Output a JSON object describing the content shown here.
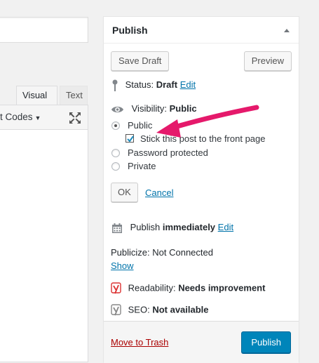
{
  "editor": {
    "tabs": [
      "Visual",
      "Text"
    ],
    "toolbar_label": "t Codes",
    "toolbar_caret": "▼"
  },
  "publish": {
    "title": "Publish",
    "save_draft_label": "Save Draft",
    "preview_label": "Preview",
    "status_label": "Status:",
    "status_value": "Draft",
    "status_edit": "Edit",
    "visibility_label": "Visibility:",
    "visibility_value": "Public",
    "options": {
      "public": "Public",
      "sticky": "Stick this post to the front page",
      "password": "Password protected",
      "private": "Private"
    },
    "ok_label": "OK",
    "cancel_label": "Cancel",
    "schedule_label": "Publish",
    "schedule_value": "immediately",
    "schedule_edit": "Edit",
    "publicize_label": "Publicize: Not Connected",
    "publicize_show": "Show",
    "readability_label": "Readability:",
    "readability_value": "Needs improvement",
    "seo_label": "SEO:",
    "seo_value": "Not available",
    "trash_label": "Move to Trash",
    "publish_label": "Publish"
  },
  "colors": {
    "accent": "#0085ba",
    "link": "#0073aa",
    "trash": "#aa0000",
    "annotation_arrow": "#e5196b",
    "yoast_red": "#dc3232"
  },
  "icons": [
    "pin-icon",
    "eye-icon",
    "calendar-icon",
    "yoast-icon",
    "expand-icon",
    "collapse-toggle-icon"
  ]
}
